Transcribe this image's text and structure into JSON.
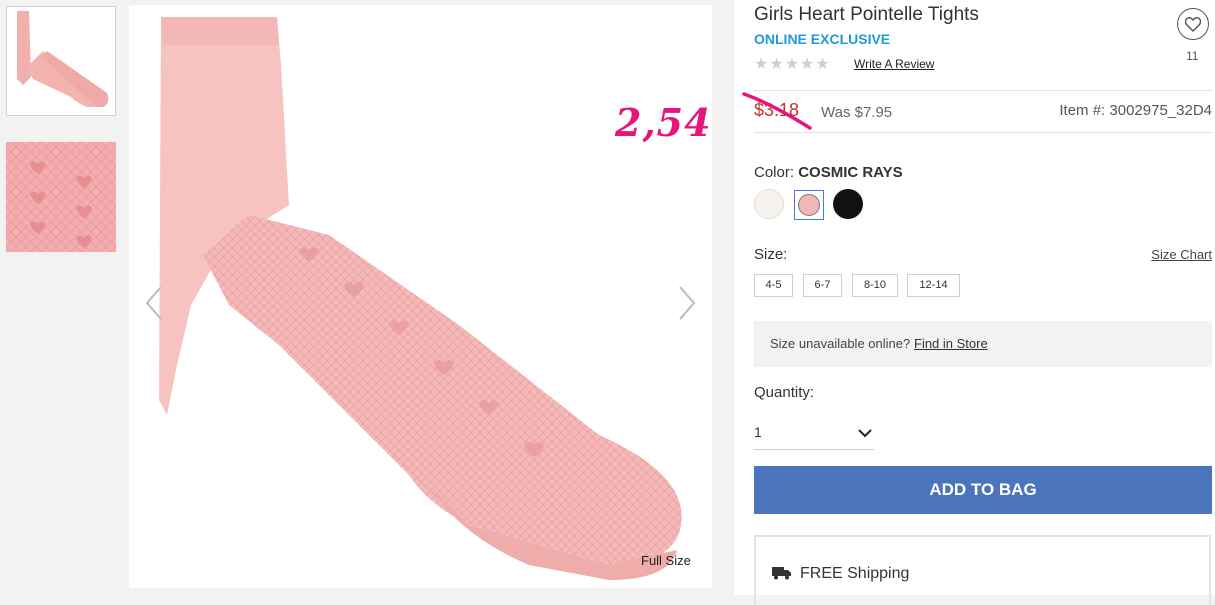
{
  "gallery": {
    "full_size_label": "Full Size",
    "overlay_annotation": "2,54"
  },
  "product": {
    "title": "Girls Heart Pointelle Tights",
    "exclusive_badge": "ONLINE EXCLUSIVE",
    "rating_stars": "★★★★★",
    "write_review": "Write A Review",
    "wishlist_count": "11",
    "sale_price": "$3.18",
    "was_price": "Was $7.95",
    "item_number": "Item #: 3002975_32D4"
  },
  "color": {
    "label": "Color:",
    "selected": "COSMIC RAYS",
    "swatches": [
      "#f6f2ee",
      "#f2b6b4",
      "#111111"
    ]
  },
  "size": {
    "label": "Size:",
    "chart_link": "Size Chart",
    "options": [
      "4-5",
      "6-7",
      "8-10",
      "12-14"
    ],
    "unavailable_text": "Size unavailable online?",
    "find_in_store": "Find in Store"
  },
  "quantity": {
    "label": "Quantity:",
    "value": "1"
  },
  "actions": {
    "add_to_bag": "ADD TO BAG",
    "free_shipping": "FREE Shipping"
  },
  "colors": {
    "accent_blue": "#4a74bc",
    "exclusive_blue": "#1d9bd8",
    "annotation_pink": "#e6147b",
    "price_red": "#c0392b"
  }
}
